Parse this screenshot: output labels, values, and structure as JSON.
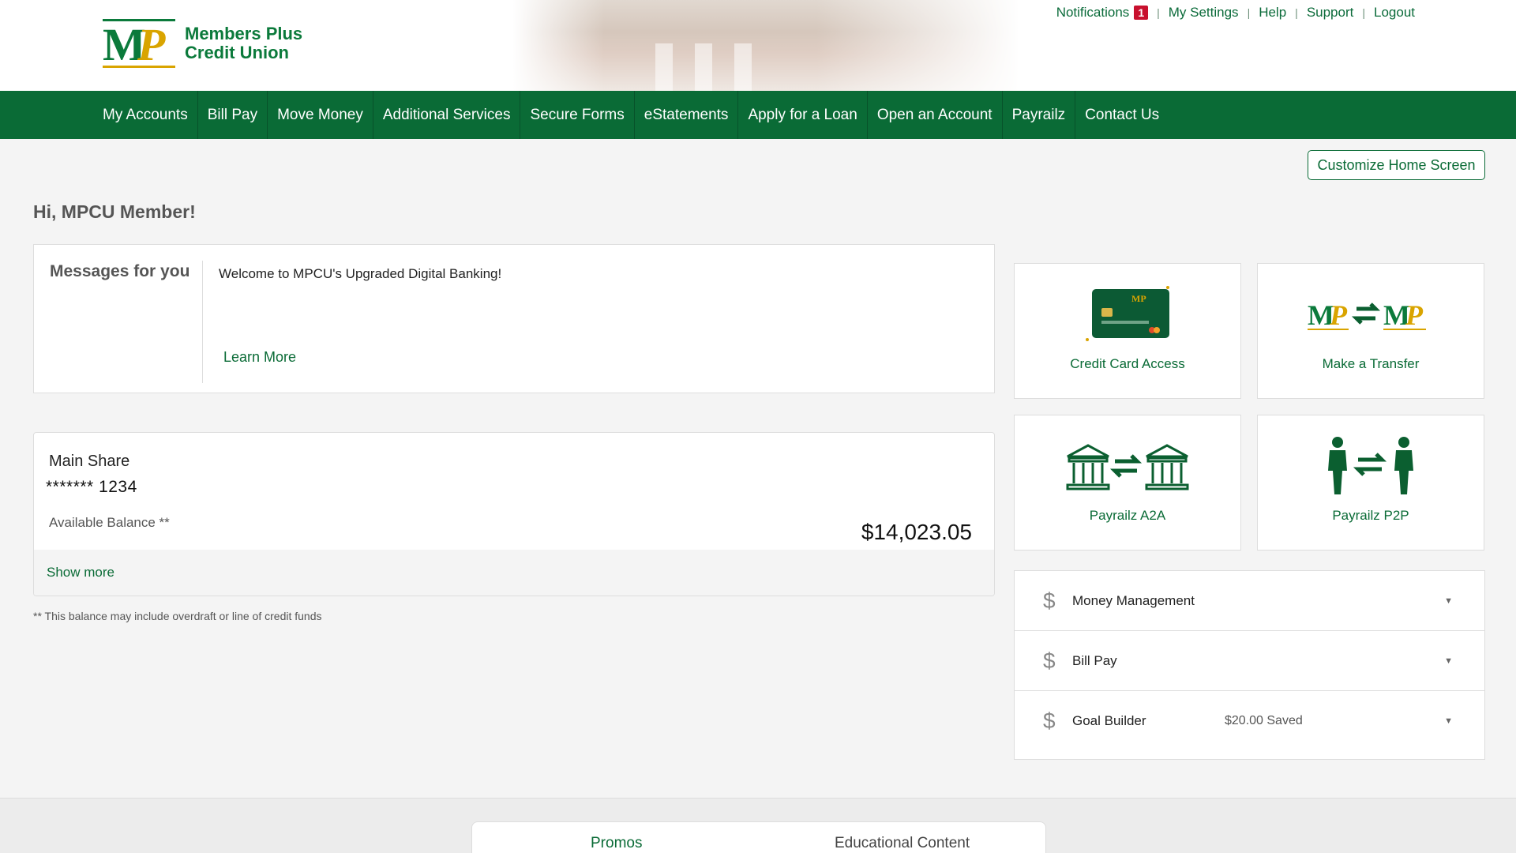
{
  "header": {
    "logo_name_line1": "Members Plus",
    "logo_name_line2": "Credit Union",
    "logo_letters": "MP",
    "top_links": {
      "notifications": "Notifications",
      "notifications_count": "1",
      "settings": "My Settings",
      "help": "Help",
      "support": "Support",
      "logout": "Logout"
    }
  },
  "nav": {
    "items": [
      "My Accounts",
      "Bill Pay",
      "Move Money",
      "Additional Services",
      "Secure Forms",
      "eStatements",
      "Apply for a Loan",
      "Open an Account",
      "Payrailz",
      "Contact Us"
    ]
  },
  "customize_label": "Customize Home Screen",
  "greeting": "Hi, MPCU Member!",
  "messages": {
    "title": "Messages for you",
    "text": "Welcome to MPCU's Upgraded Digital Banking!",
    "link": "Learn More"
  },
  "account": {
    "name": "Main Share",
    "number": "******* 1234",
    "balance_label": "Available Balance **",
    "balance": "$14,023.05",
    "show_more": "Show more"
  },
  "footnote": "** This balance may include overdraft or line of credit funds",
  "tiles": [
    {
      "label": "Credit Card Access",
      "icon": "credit-card-icon"
    },
    {
      "label": "Make a Transfer",
      "icon": "transfer-icon"
    },
    {
      "label": "Payrailz A2A",
      "icon": "bank-transfer-icon"
    },
    {
      "label": "Payrailz P2P",
      "icon": "person-transfer-icon"
    }
  ],
  "accordion": [
    {
      "label": "Money Management",
      "value": ""
    },
    {
      "label": "Bill Pay",
      "value": ""
    },
    {
      "label": "Goal Builder",
      "value": "$20.00 Saved"
    }
  ],
  "bottom_tabs": {
    "promos": "Promos",
    "educational": "Educational Content"
  },
  "colors": {
    "brand_green": "#0a6b36",
    "brand_gold": "#d9a400",
    "alert_red": "#c8102e"
  }
}
